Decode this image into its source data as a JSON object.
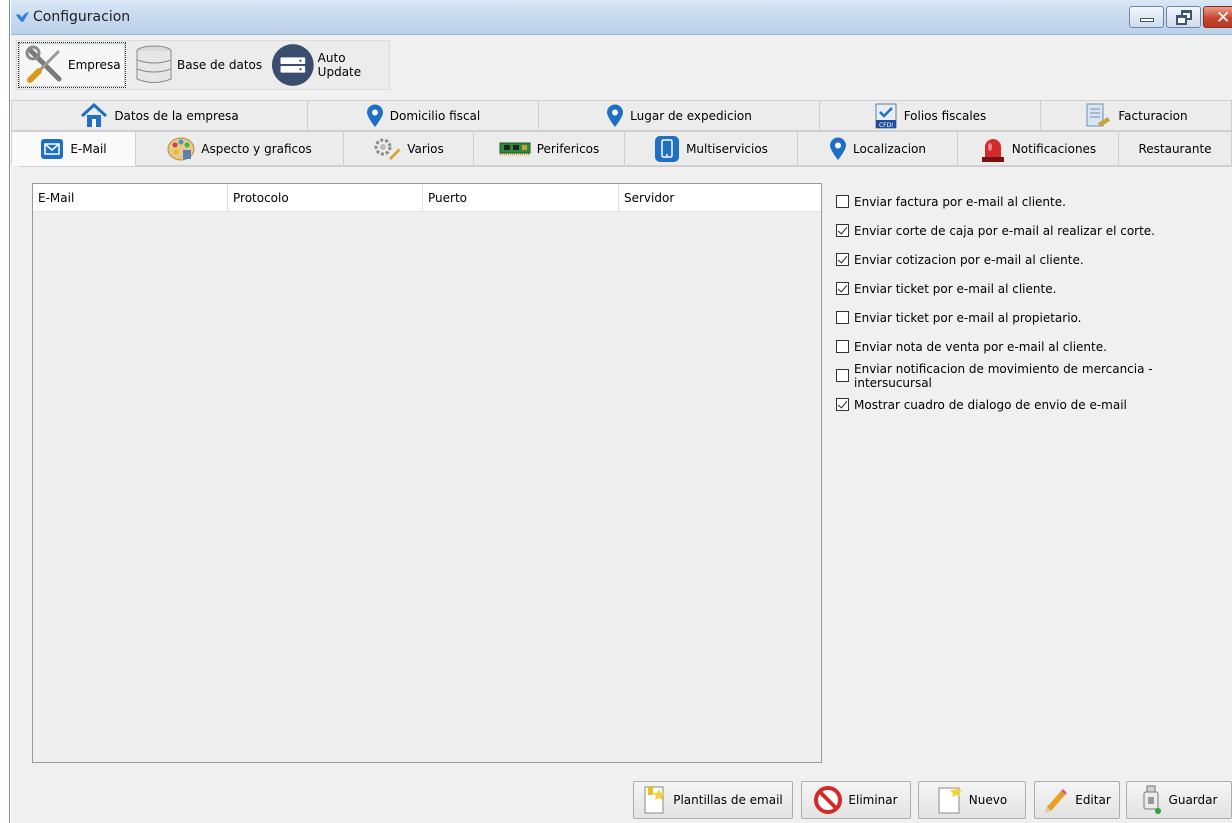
{
  "window": {
    "title": "Configuracion",
    "controls": [
      "minimize",
      "restore",
      "close"
    ]
  },
  "modules": [
    {
      "label": "Empresa",
      "icon": "tools-icon",
      "active": true
    },
    {
      "label": "Base de datos",
      "icon": "database-icon",
      "active": false
    },
    {
      "label": "Auto Update",
      "icon": "server-icon",
      "active": false
    }
  ],
  "tabs_row1": [
    {
      "label": "Datos de la empresa",
      "icon": "house-icon"
    },
    {
      "label": "Domicilio fiscal",
      "icon": "location-pin-icon"
    },
    {
      "label": "Lugar de expedicion",
      "icon": "location-pin-icon"
    },
    {
      "label": "Folios fiscales",
      "icon": "cfdi-icon"
    },
    {
      "label": "Facturacion",
      "icon": "invoice-icon"
    }
  ],
  "tabs_row2": [
    {
      "label": "E-Mail",
      "icon": "mail-icon",
      "active": true
    },
    {
      "label": "Aspecto y graficos",
      "icon": "palette-icon"
    },
    {
      "label": "Varios",
      "icon": "gears-icon"
    },
    {
      "label": "Perifericos",
      "icon": "circuit-board-icon"
    },
    {
      "label": "Multiservicios",
      "icon": "phone-icon"
    },
    {
      "label": "Localizacion",
      "icon": "location-pin-icon"
    },
    {
      "label": "Notificaciones",
      "icon": "alarm-light-icon"
    },
    {
      "label": "Restaurante",
      "icon": ""
    }
  ],
  "email_table": {
    "columns": [
      "E-Mail",
      "Protocolo",
      "Puerto",
      "Servidor"
    ],
    "rows": []
  },
  "options": [
    {
      "label": "Enviar factura por e-mail al cliente.",
      "checked": false
    },
    {
      "label": "Enviar corte de caja por e-mail al realizar el corte.",
      "checked": true
    },
    {
      "label": "Enviar cotizacion por e-mail al cliente.",
      "checked": true
    },
    {
      "label": "Enviar ticket por e-mail al cliente.",
      "checked": true
    },
    {
      "label": "Enviar ticket por e-mail al propietario.",
      "checked": false
    },
    {
      "label": "Enviar nota de venta por e-mail al cliente.",
      "checked": false
    },
    {
      "label": "Enviar notificacion de movimiento de mercancia - intersucursal",
      "checked": false
    },
    {
      "label": "Mostrar cuadro de dialogo de envio de e-mail",
      "checked": true
    }
  ],
  "buttons": {
    "plantillas": "Plantillas de email",
    "eliminar": "Eliminar",
    "nuevo": "Nuevo",
    "editar": "Editar",
    "guardar": "Guardar"
  },
  "colors": {
    "titlebar": "#c5d8ee",
    "close_button": "#c6462d",
    "pin_blue": "#1f6fc4",
    "panel_bg": "#f0f0f0"
  }
}
